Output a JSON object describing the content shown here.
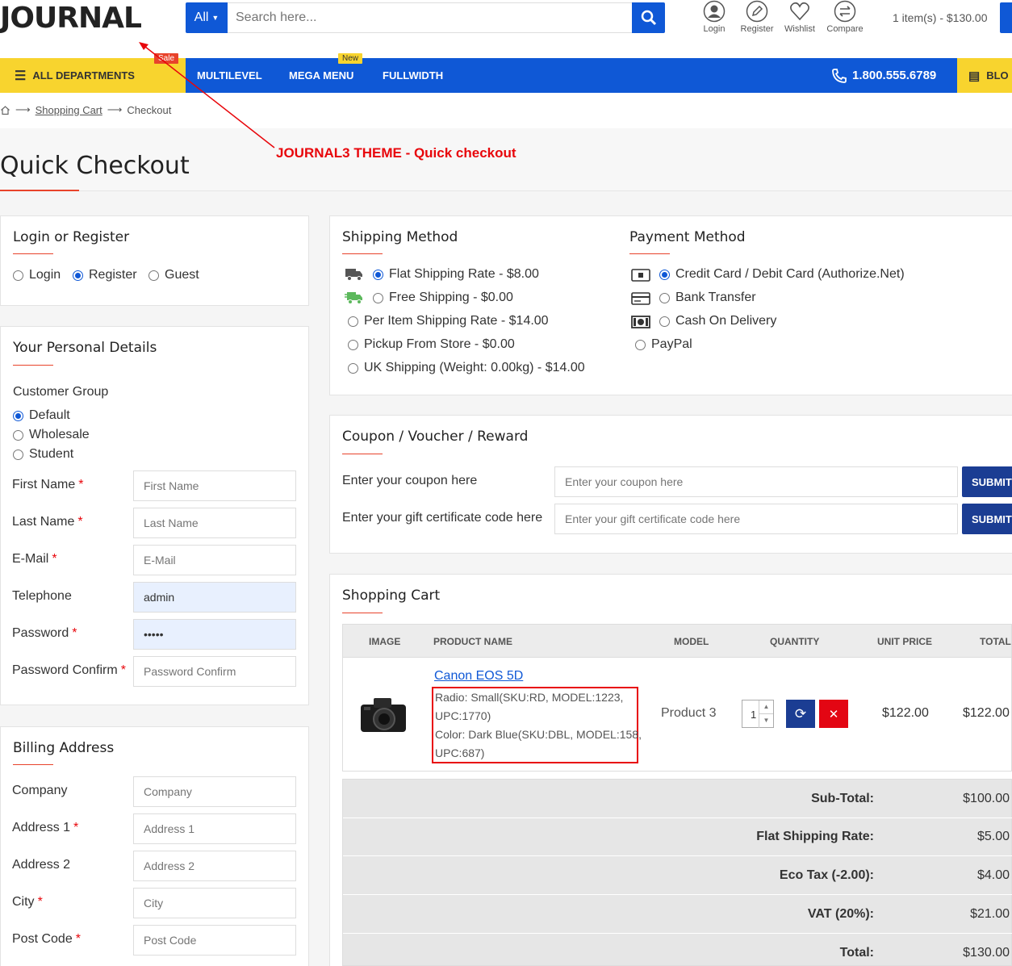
{
  "header": {
    "logo": "JOURNAL",
    "search": {
      "category": "All",
      "placeholder": "Search here..."
    },
    "icons": [
      {
        "label": "Login",
        "icon": "user-icon"
      },
      {
        "label": "Register",
        "icon": "pencil-icon"
      },
      {
        "label": "Wishlist",
        "icon": "heart-icon"
      },
      {
        "label": "Compare",
        "icon": "compare-icon"
      }
    ],
    "cart_summary": "1 item(s) - $130.00"
  },
  "nav": {
    "departments": "ALL DEPARTMENTS",
    "items": [
      "MULTILEVEL",
      "MEGA MENU",
      "FULLWIDTH"
    ],
    "badges": {
      "sale": "Sale",
      "new": "New"
    },
    "phone": "1.800.555.6789",
    "blog": "BLO"
  },
  "breadcrumb": [
    "Shopping Cart",
    "Checkout"
  ],
  "page_title": "Quick Checkout",
  "annotation": "JOURNAL3 THEME - Quick checkout",
  "login": {
    "title": "Login or Register",
    "options": [
      "Login",
      "Register",
      "Guest"
    ],
    "selected": "Register"
  },
  "personal": {
    "title": "Your Personal Details",
    "group_label": "Customer Group",
    "groups": [
      "Default",
      "Wholesale",
      "Student"
    ],
    "fields": [
      {
        "label": "First Name",
        "placeholder": "First Name",
        "value": "",
        "required": true
      },
      {
        "label": "Last Name",
        "placeholder": "Last Name",
        "value": "",
        "required": true
      },
      {
        "label": "E-Mail",
        "placeholder": "E-Mail",
        "value": "",
        "required": true
      },
      {
        "label": "Telephone",
        "placeholder": "Telephone",
        "value": "admin",
        "required": false
      },
      {
        "label": "Password",
        "placeholder": "Password",
        "value": "•••••",
        "required": true
      },
      {
        "label": "Password Confirm",
        "placeholder": "Password Confirm",
        "value": "",
        "required": true
      }
    ]
  },
  "billing": {
    "title": "Billing Address",
    "fields": [
      {
        "label": "Company",
        "placeholder": "Company",
        "required": false
      },
      {
        "label": "Address 1",
        "placeholder": "Address 1",
        "required": true
      },
      {
        "label": "Address 2",
        "placeholder": "Address 2",
        "required": false
      },
      {
        "label": "City",
        "placeholder": "City",
        "required": true
      },
      {
        "label": "Post Code",
        "placeholder": "Post Code",
        "required": true
      }
    ]
  },
  "shipping": {
    "title": "Shipping Method",
    "options": [
      "Flat Shipping Rate - $8.00",
      "Free Shipping - $0.00",
      "Per Item Shipping Rate - $14.00",
      "Pickup From Store - $0.00",
      "UK Shipping (Weight: 0.00kg) - $14.00"
    ]
  },
  "payment": {
    "title": "Payment Method",
    "options": [
      "Credit Card / Debit Card (Authorize.Net)",
      "Bank Transfer",
      "Cash On Delivery",
      "PayPal"
    ]
  },
  "coupon": {
    "title": "Coupon / Voucher / Reward",
    "coupon_label": "Enter your coupon here",
    "coupon_placeholder": "Enter your coupon here",
    "gift_label": "Enter your gift certificate code here",
    "gift_placeholder": "Enter your gift certificate code here",
    "submit": "SUBMIT"
  },
  "cart": {
    "title": "Shopping Cart",
    "columns": [
      "IMAGE",
      "PRODUCT NAME",
      "MODEL",
      "QUANTITY",
      "UNIT PRICE",
      "TOTAL"
    ],
    "item": {
      "name": "Canon EOS 5D",
      "options": [
        "Radio: Small(SKU:RD, MODEL:1223,",
        "UPC:1770)",
        "Color: Dark Blue(SKU:DBL, MODEL:158,",
        "UPC:687)"
      ],
      "model": "Product 3",
      "quantity": "1",
      "unit_price": "$122.00",
      "total": "$122.00"
    },
    "totals": [
      {
        "label": "Sub-Total:",
        "value": "$100.00"
      },
      {
        "label": "Flat Shipping Rate:",
        "value": "$5.00"
      },
      {
        "label": "Eco Tax (-2.00):",
        "value": "$4.00"
      },
      {
        "label": "VAT (20%):",
        "value": "$21.00"
      },
      {
        "label": "Total:",
        "value": "$130.00"
      }
    ]
  }
}
